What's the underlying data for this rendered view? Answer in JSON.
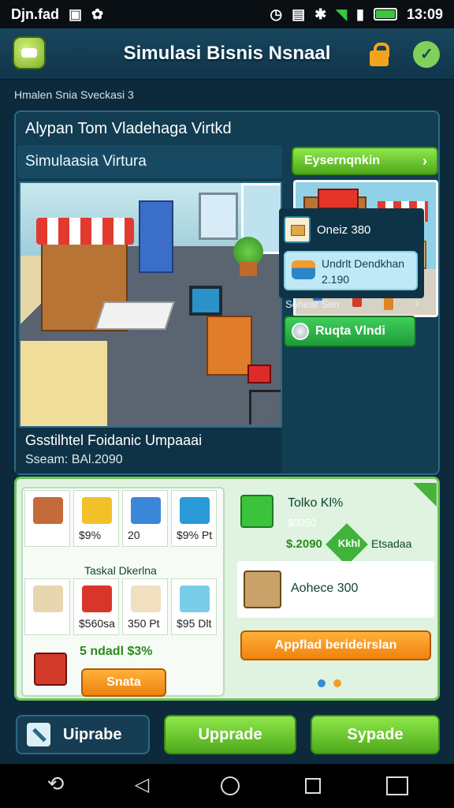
{
  "status": {
    "left_text": "Djn.fad",
    "time": "13:09"
  },
  "header": {
    "title": "Simulasi Bisnis Nsnaal"
  },
  "breadcrumb": "Hmalen Snia Sveckasi 3",
  "main": {
    "heading": "Alypan Tom Vladehaga Virtkd",
    "subheading": "Simulaasia Virtura",
    "cta_label": "Eysernqnkin",
    "caption_title": "Gsstilhtel Foidanic Umpaaai",
    "caption_sub": "Sseam: BAl.2090"
  },
  "side": {
    "stat1": "Oneiz 380",
    "stat2_line1": "Undrlt Dendkhan",
    "stat2_line2": "2.190",
    "link_label": "Sohear Sen",
    "cta_label": "Ruqta Vlndi"
  },
  "shop": {
    "section_title": "Taskal Dkerlna",
    "tiles": [
      {
        "label": ""
      },
      {
        "label": "$9%"
      },
      {
        "label": "20"
      },
      {
        "label": "$9% Pt"
      },
      {
        "label": ""
      },
      {
        "label": "$560sa"
      },
      {
        "label": "350 Pt"
      },
      {
        "label": "$95 Dlt"
      }
    ],
    "bundle_label": "5 ndadl $3%",
    "bundle_button": "Snata"
  },
  "offer": {
    "title": "Tolko Kl%",
    "old_price": "$0050",
    "price": "$.2090",
    "badge": "Kkhl",
    "unit": "Etsadaa",
    "item2_label": "Aohece 300",
    "apply_button": "Appflad berideirslan"
  },
  "bottom": {
    "btn1": "Uiprabe",
    "btn2": "Upprade",
    "btn3": "Sypade"
  },
  "colors": {
    "accent_green": "#4fa91c",
    "accent_orange": "#f0820e",
    "panel_teal": "#123d52"
  }
}
